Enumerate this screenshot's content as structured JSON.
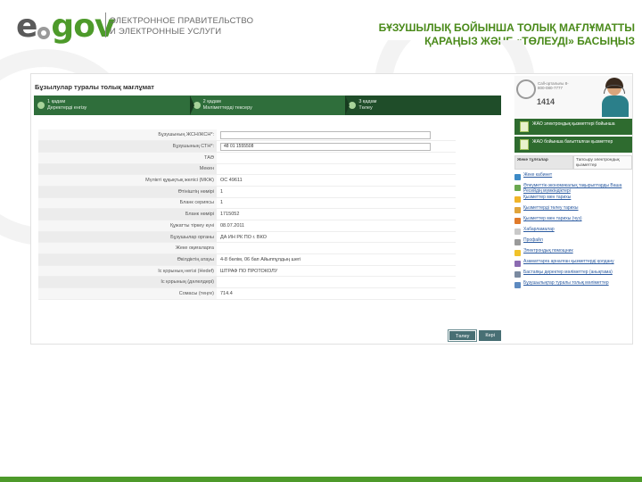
{
  "header": {
    "logo_e": "e",
    "logo_gov": "gov",
    "subtitle_line1": "ЭЛЕКТРОННОЕ ПРАВИТЕЛЬСТВО",
    "subtitle_line2": "И ЭЛЕКТРОННЫЕ УСЛУГИ",
    "slide_title_line1": "БҰЗУШЫЛЫҚ БОЙЫНША ТОЛЫҚ МАҒЛҰМАТТЫ",
    "slide_title_line2": "ҚАРАҢЫЗ ЖӘНЕ «ТӨЛЕУДІ» БАСЫҢЫЗ"
  },
  "colors": {
    "brand_green": "#4d9a2a",
    "step_bar": "#2f6e3b",
    "button": "#486f74",
    "link": "#2a5aa0"
  },
  "main": {
    "title": "Бұзылулар туралы толық мағлұмат",
    "steps": [
      {
        "line1": "1 қадам",
        "line2": "Деректерді енгізу"
      },
      {
        "line1": "2 қадам",
        "line2": "Мәліметтерді тексеру"
      },
      {
        "line1": "3 қадам",
        "line2": "Төлеу"
      }
    ],
    "active_step": 3,
    "form": [
      {
        "label": "Бұзушының ЖСН/ЖСН*:",
        "value": "",
        "type": "input"
      },
      {
        "label": "Бұзушының СТН*:",
        "value": "48 01 1555508",
        "type": "input"
      },
      {
        "label": "ТАӘ",
        "value": ""
      },
      {
        "label": "Мекен",
        "value": ""
      },
      {
        "label": "Мүлікті құқықтық желісі (МКЖ)",
        "value": "ОС 49611"
      },
      {
        "label": "Өтініштің нөмірі",
        "value": "1"
      },
      {
        "label": "Бланк сериясы",
        "value": "1"
      },
      {
        "label": "Бланк нөмірі",
        "value": "1715052"
      },
      {
        "label": "Құжатты тіркеу күні",
        "value": "08.07.2011"
      },
      {
        "label": "Бұзушылар органы",
        "value": "ДА ИН РК ПО г. ВКО"
      },
      {
        "label": "Жеке оқиғаларға",
        "value": ""
      },
      {
        "label": "Өкілдіктің атауы",
        "value": "4-8 бөлім, 06 бап Айыппұлдың шегі"
      },
      {
        "label": "Іс қорының негізі (Hedef)",
        "value": "ШТРАФ ПО ПРОТОКОЛУ"
      },
      {
        "label": "Іс қорының (дәлелдері)",
        "value": ""
      },
      {
        "label": "Сомасы (теңге)",
        "value": "714.4"
      }
    ],
    "btn_pay": "Төлеу",
    "btn_back": "Кері"
  },
  "sidebar": {
    "call_label": "Call-орталығы 8-800-080-7777",
    "call_number": "1414",
    "banner1": "ЖАО электрондық қызметтері бойынша",
    "banner2": "ЖАО бойынша бағытталған қызметтер",
    "tabs": [
      {
        "label": "Жеке тұлғалар",
        "active": true
      },
      {
        "label": "Тапсыру электрондық қызметтер",
        "active": false
      }
    ],
    "services": [
      {
        "text": "Жеке кабинет",
        "color": "#3c8ac6"
      },
      {
        "text": "Әлеуметтік-экономикалық тақырыптарды Ваша Ресейдің мүмкіндіктері",
        "color": "#6aa84f"
      },
      {
        "text": "Қызметтер мен тарихы",
        "color": "#f0b429"
      },
      {
        "text": "Қызметтерді төлеу тарихы",
        "color": "#e0a43a"
      },
      {
        "text": "Қызметтер мен тарихы (чуз)",
        "color": "#e07a2a"
      },
      {
        "text": "Хабарламалар",
        "color": "#c9c9c9"
      },
      {
        "text": "Профайл",
        "color": "#9a9a9a"
      },
      {
        "text": "Электрондық помощник",
        "color": "#f0c22a"
      },
      {
        "text": "Азаматтарға арналған қызметтерді қолдану",
        "color": "#8b6bb1"
      },
      {
        "text": "Бастапқы деректер мәліметтер (анықтама)",
        "color": "#7a8aa0"
      },
      {
        "text": "Бұзушылықтар туралы толық мәліметтер",
        "color": "#5d8ac0"
      }
    ]
  }
}
